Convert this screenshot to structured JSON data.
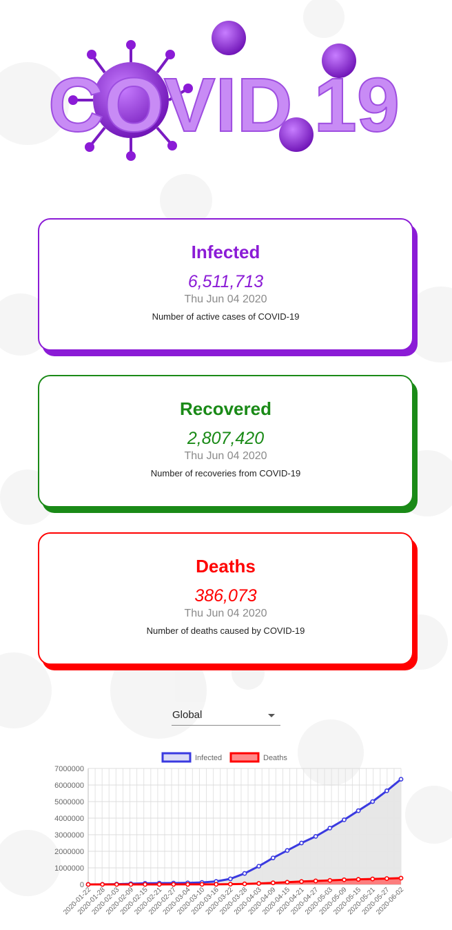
{
  "logo": {
    "text": "COVID 19"
  },
  "cards": [
    {
      "title": "Infected",
      "value": "6,511,713",
      "date": "Thu Jun 04 2020",
      "description": "Number of active cases of COVID-19",
      "color": "#8b1bd6"
    },
    {
      "title": "Recovered",
      "value": "2,807,420",
      "date": "Thu Jun 04 2020",
      "description": "Number of recoveries from COVID-19",
      "color": "#1a8a17"
    },
    {
      "title": "Deaths",
      "value": "386,073",
      "date": "Thu Jun 04 2020",
      "description": "Number of deaths caused by COVID-19",
      "color": "#ff0000"
    }
  ],
  "country_select": {
    "value": "Global"
  },
  "chart_data": {
    "type": "line",
    "categories": [
      "2020-01-22",
      "2020-01-28",
      "2020-02-03",
      "2020-02-09",
      "2020-02-15",
      "2020-02-21",
      "2020-02-27",
      "2020-03-04",
      "2020-03-10",
      "2020-03-16",
      "2020-03-22",
      "2020-03-28",
      "2020-04-03",
      "2020-04-09",
      "2020-04-15",
      "2020-04-21",
      "2020-04-27",
      "2020-05-03",
      "2020-05-09",
      "2020-05-15",
      "2020-05-21",
      "2020-05-27",
      "2020-06-02"
    ],
    "series": [
      {
        "name": "Infected",
        "color": "#3a3ae0",
        "fill": "#e6e6e6",
        "values": [
          555,
          5580,
          17300,
          40000,
          69000,
          77000,
          83000,
          95000,
          119000,
          182000,
          337000,
          664000,
          1100000,
          1600000,
          2050000,
          2500000,
          2900000,
          3400000,
          3900000,
          4450000,
          5000000,
          5650000,
          6350000
        ]
      },
      {
        "name": "Deaths",
        "color": "#ff0000",
        "fill": "#ff6b6b",
        "values": [
          17,
          132,
          425,
          905,
          1500,
          2250,
          2800,
          3300,
          4300,
          7100,
          14600,
          33000,
          59000,
          96000,
          135000,
          175000,
          210000,
          245000,
          280000,
          305000,
          330000,
          355000,
          380000
        ]
      }
    ],
    "y_ticks": [
      "0",
      "1000000",
      "2000000",
      "3000000",
      "4000000",
      "5000000",
      "6000000",
      "7000000"
    ],
    "ylim": [
      0,
      7000000
    ],
    "grid": true,
    "legend": "top-center"
  }
}
